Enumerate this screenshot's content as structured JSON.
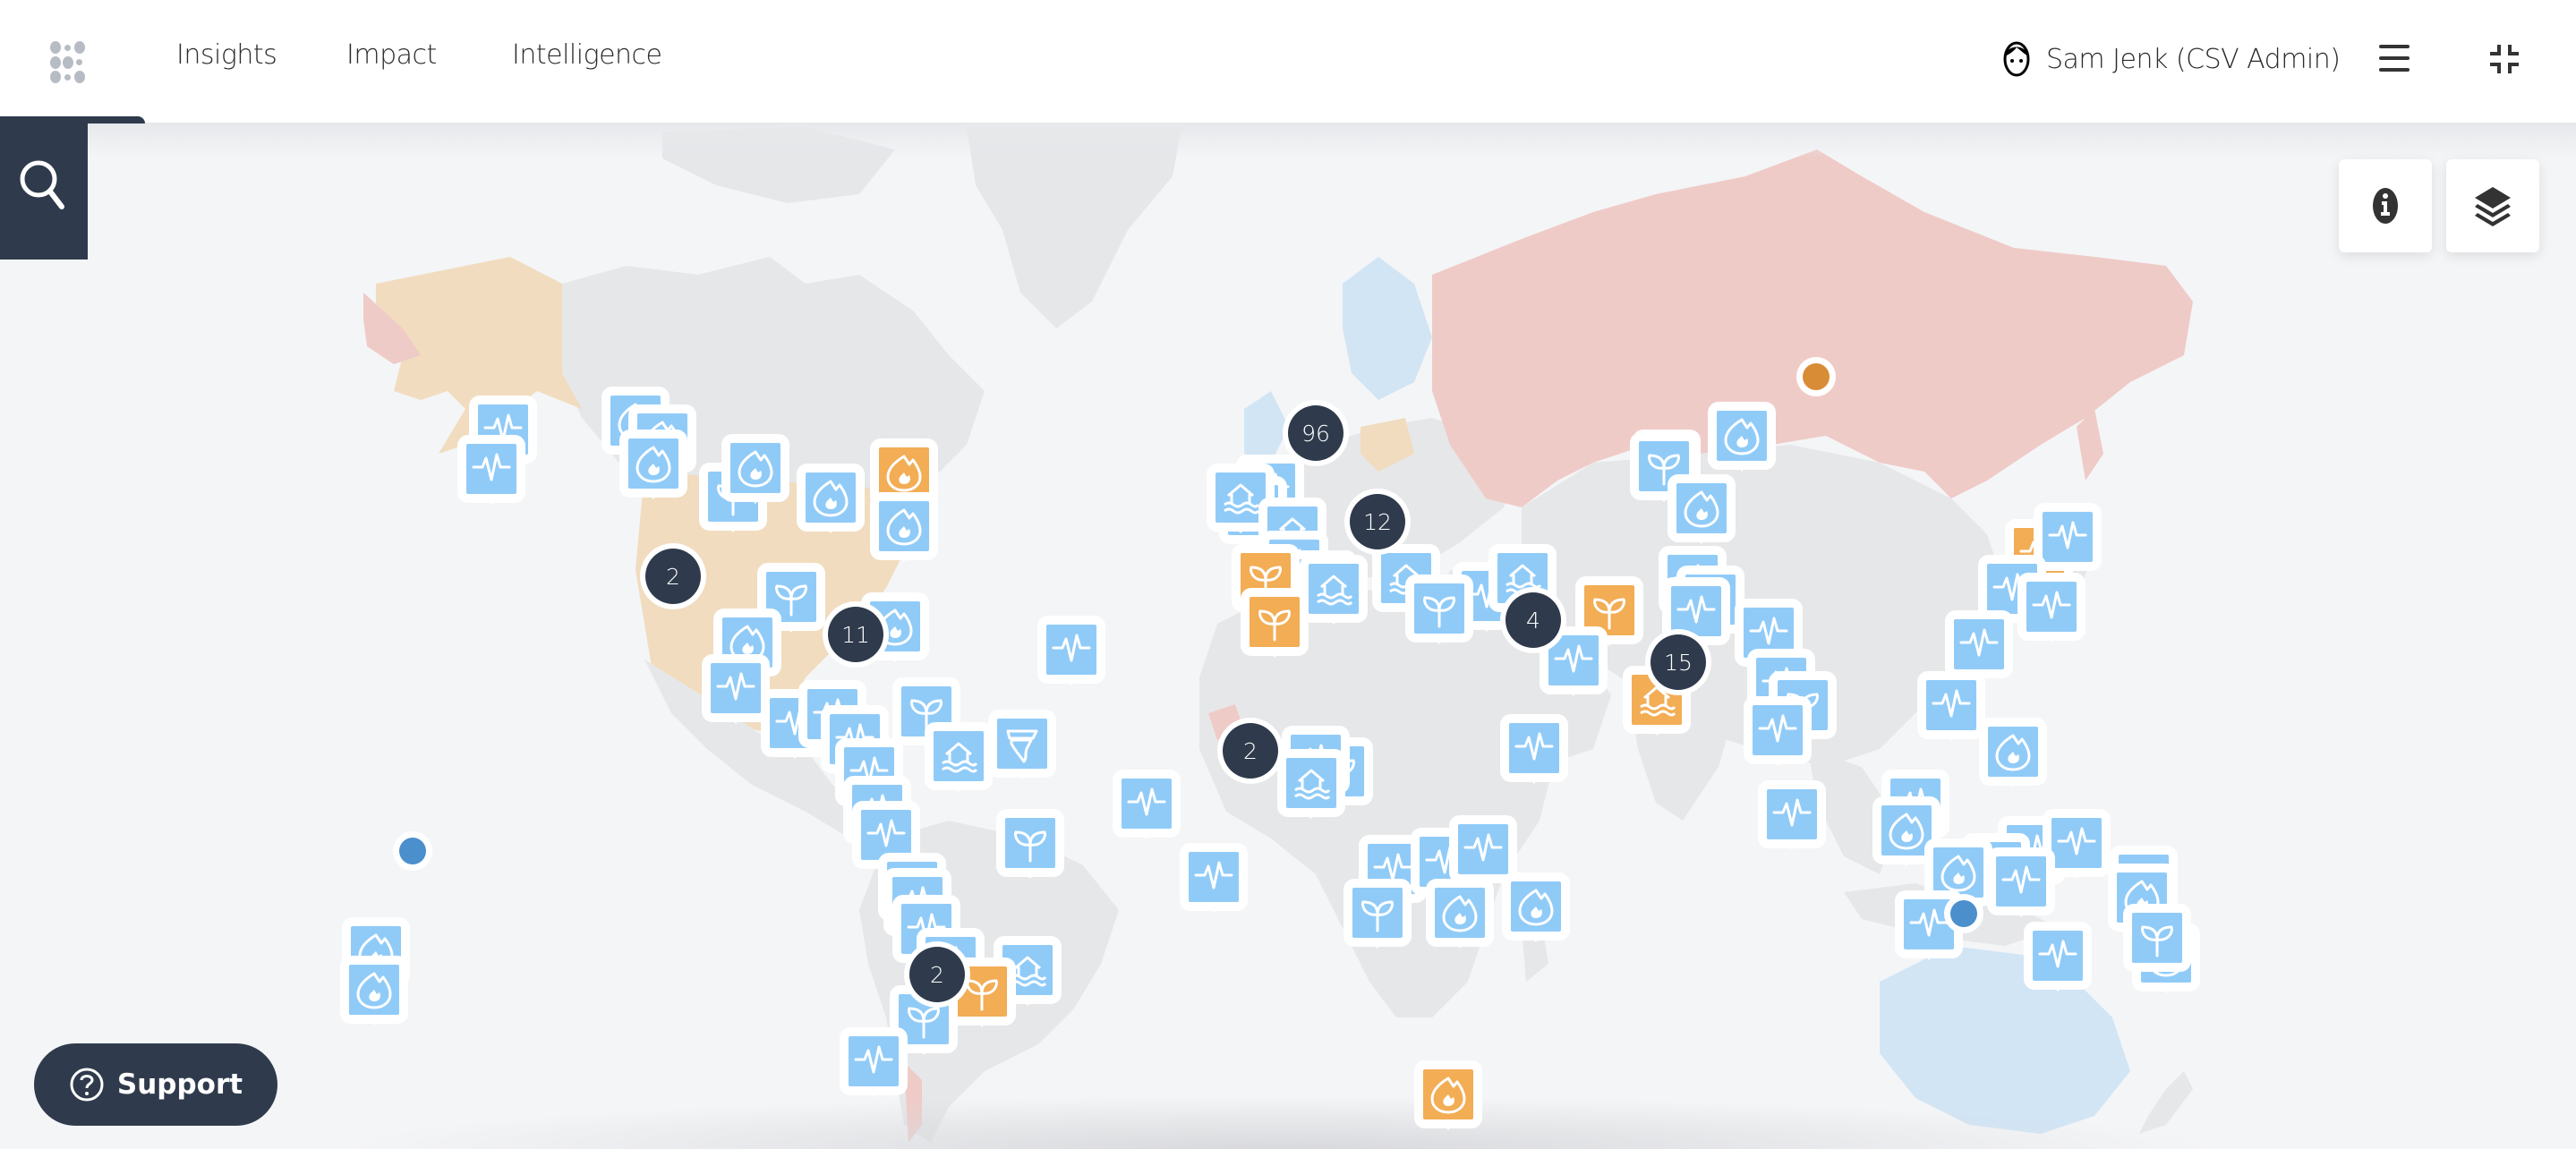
{
  "header": {
    "nav": [
      {
        "label": "Insights"
      },
      {
        "label": "Impact"
      },
      {
        "label": "Intelligence"
      }
    ],
    "user": {
      "name": "Sam Jenk (CSV Admin)",
      "icon": "user-avatar-icon"
    },
    "menu_icon": "hamburger-menu-icon",
    "collapse_icon": "collapse-fullscreen-icon",
    "app_icon": "app-grid-icon"
  },
  "search": {
    "icon": "search-icon"
  },
  "map_controls": [
    {
      "name": "info",
      "icon": "info-icon"
    },
    {
      "name": "layers",
      "icon": "layers-icon"
    }
  ],
  "support": {
    "label": "Support",
    "icon": "help-circle-icon"
  },
  "colors": {
    "dark": "#2f3b4c",
    "marker_blue": "#90cbf8",
    "marker_orange": "#f2ad55",
    "dot_orange": "#d98c36",
    "dot_blue": "#4b8fcc",
    "region_red": "#efcbc7",
    "region_tan": "#f1dcbf",
    "region_lightblue": "#d2e5f5",
    "land_grey": "#e6e7e9"
  },
  "legend_types": {
    "pulse": "earthquake",
    "flame": "wildfire",
    "sprout": "drought",
    "flood": "flood",
    "tornado": "storm"
  },
  "clusters": [
    {
      "count": "96"
    },
    {
      "count": "12"
    },
    {
      "count": "2"
    },
    {
      "count": "11"
    },
    {
      "count": "4"
    },
    {
      "count": "15"
    },
    {
      "count": "2"
    },
    {
      "count": "2"
    }
  ],
  "markers": [
    {
      "type": "pulse",
      "color": "blue"
    },
    {
      "type": "pulse",
      "color": "blue"
    },
    {
      "type": "flame",
      "color": "blue"
    },
    {
      "type": "flame",
      "color": "blue"
    },
    {
      "type": "flame",
      "color": "blue"
    },
    {
      "type": "sprout",
      "color": "blue"
    },
    {
      "type": "flame",
      "color": "orange"
    },
    {
      "type": "flame",
      "color": "blue"
    },
    {
      "type": "flame",
      "color": "blue"
    },
    {
      "type": "flame",
      "color": "blue"
    },
    {
      "type": "sprout",
      "color": "blue"
    },
    {
      "type": "flame",
      "color": "blue"
    },
    {
      "type": "flame",
      "color": "blue"
    },
    {
      "type": "pulse",
      "color": "blue"
    },
    {
      "type": "pulse",
      "color": "blue"
    },
    {
      "type": "pulse",
      "color": "blue"
    },
    {
      "type": "pulse",
      "color": "blue"
    },
    {
      "type": "sprout",
      "color": "blue"
    },
    {
      "type": "flood",
      "color": "blue"
    },
    {
      "type": "tornado",
      "color": "blue"
    },
    {
      "type": "pulse",
      "color": "blue"
    },
    {
      "type": "pulse",
      "color": "blue"
    },
    {
      "type": "pulse",
      "color": "blue"
    },
    {
      "type": "sprout",
      "color": "blue"
    },
    {
      "type": "pulse",
      "color": "blue"
    },
    {
      "type": "pulse",
      "color": "blue"
    },
    {
      "type": "pulse",
      "color": "blue"
    },
    {
      "type": "pulse",
      "color": "blue"
    },
    {
      "type": "flood",
      "color": "blue"
    },
    {
      "type": "sprout",
      "color": "orange"
    },
    {
      "type": "sprout",
      "color": "blue"
    },
    {
      "type": "pulse",
      "color": "blue"
    },
    {
      "type": "sprout",
      "color": "blue"
    },
    {
      "type": "pulse",
      "color": "blue"
    },
    {
      "type": "pulse",
      "color": "blue"
    },
    {
      "type": "pulse",
      "color": "blue"
    },
    {
      "type": "pulse",
      "color": "blue"
    },
    {
      "type": "flood",
      "color": "blue"
    },
    {
      "type": "flood",
      "color": "blue"
    },
    {
      "type": "pulse",
      "color": "blue"
    },
    {
      "type": "sprout",
      "color": "blue"
    },
    {
      "type": "sprout",
      "color": "orange"
    },
    {
      "type": "sprout",
      "color": "orange"
    },
    {
      "type": "flood",
      "color": "blue"
    },
    {
      "type": "flood",
      "color": "blue"
    },
    {
      "type": "sprout",
      "color": "blue"
    },
    {
      "type": "pulse",
      "color": "blue"
    },
    {
      "type": "flood",
      "color": "blue"
    },
    {
      "type": "pulse",
      "color": "blue"
    },
    {
      "type": "sprout",
      "color": "orange"
    },
    {
      "type": "pulse",
      "color": "blue"
    },
    {
      "type": "pulse",
      "color": "blue"
    },
    {
      "type": "flood",
      "color": "orange"
    },
    {
      "type": "pulse",
      "color": "blue"
    },
    {
      "type": "pulse",
      "color": "blue"
    },
    {
      "type": "sprout",
      "color": "blue"
    },
    {
      "type": "pulse",
      "color": "blue"
    },
    {
      "type": "pulse",
      "color": "blue"
    },
    {
      "type": "pulse",
      "color": "blue"
    },
    {
      "type": "flame",
      "color": "blue"
    },
    {
      "type": "sprout",
      "color": "blue"
    },
    {
      "type": "flame",
      "color": "blue"
    },
    {
      "type": "sprout",
      "color": "blue"
    },
    {
      "type": "flame",
      "color": "blue"
    },
    {
      "type": "flood",
      "color": "blue"
    },
    {
      "type": "sprout",
      "color": "blue"
    },
    {
      "type": "pulse",
      "color": "blue"
    },
    {
      "type": "flame",
      "color": "blue"
    },
    {
      "type": "sprout",
      "color": "blue"
    },
    {
      "type": "flame",
      "color": "blue"
    },
    {
      "type": "pulse",
      "color": "blue"
    },
    {
      "type": "pulse",
      "color": "blue"
    },
    {
      "type": "pulse",
      "color": "blue"
    },
    {
      "type": "pulse",
      "color": "blue"
    },
    {
      "type": "pulse",
      "color": "blue"
    },
    {
      "type": "pulse",
      "color": "orange"
    },
    {
      "type": "pulse",
      "color": "blue"
    },
    {
      "type": "pulse",
      "color": "blue"
    },
    {
      "type": "pulse",
      "color": "blue"
    },
    {
      "type": "pulse",
      "color": "blue"
    },
    {
      "type": "flame",
      "color": "blue"
    },
    {
      "type": "flame",
      "color": "blue"
    },
    {
      "type": "pulse",
      "color": "blue"
    },
    {
      "type": "pulse",
      "color": "blue"
    },
    {
      "type": "pulse",
      "color": "blue"
    },
    {
      "type": "pulse",
      "color": "blue"
    },
    {
      "type": "pulse",
      "color": "blue"
    }
  ],
  "dots": [
    {
      "color": "orange"
    },
    {
      "color": "blue"
    },
    {
      "color": "blue"
    }
  ]
}
